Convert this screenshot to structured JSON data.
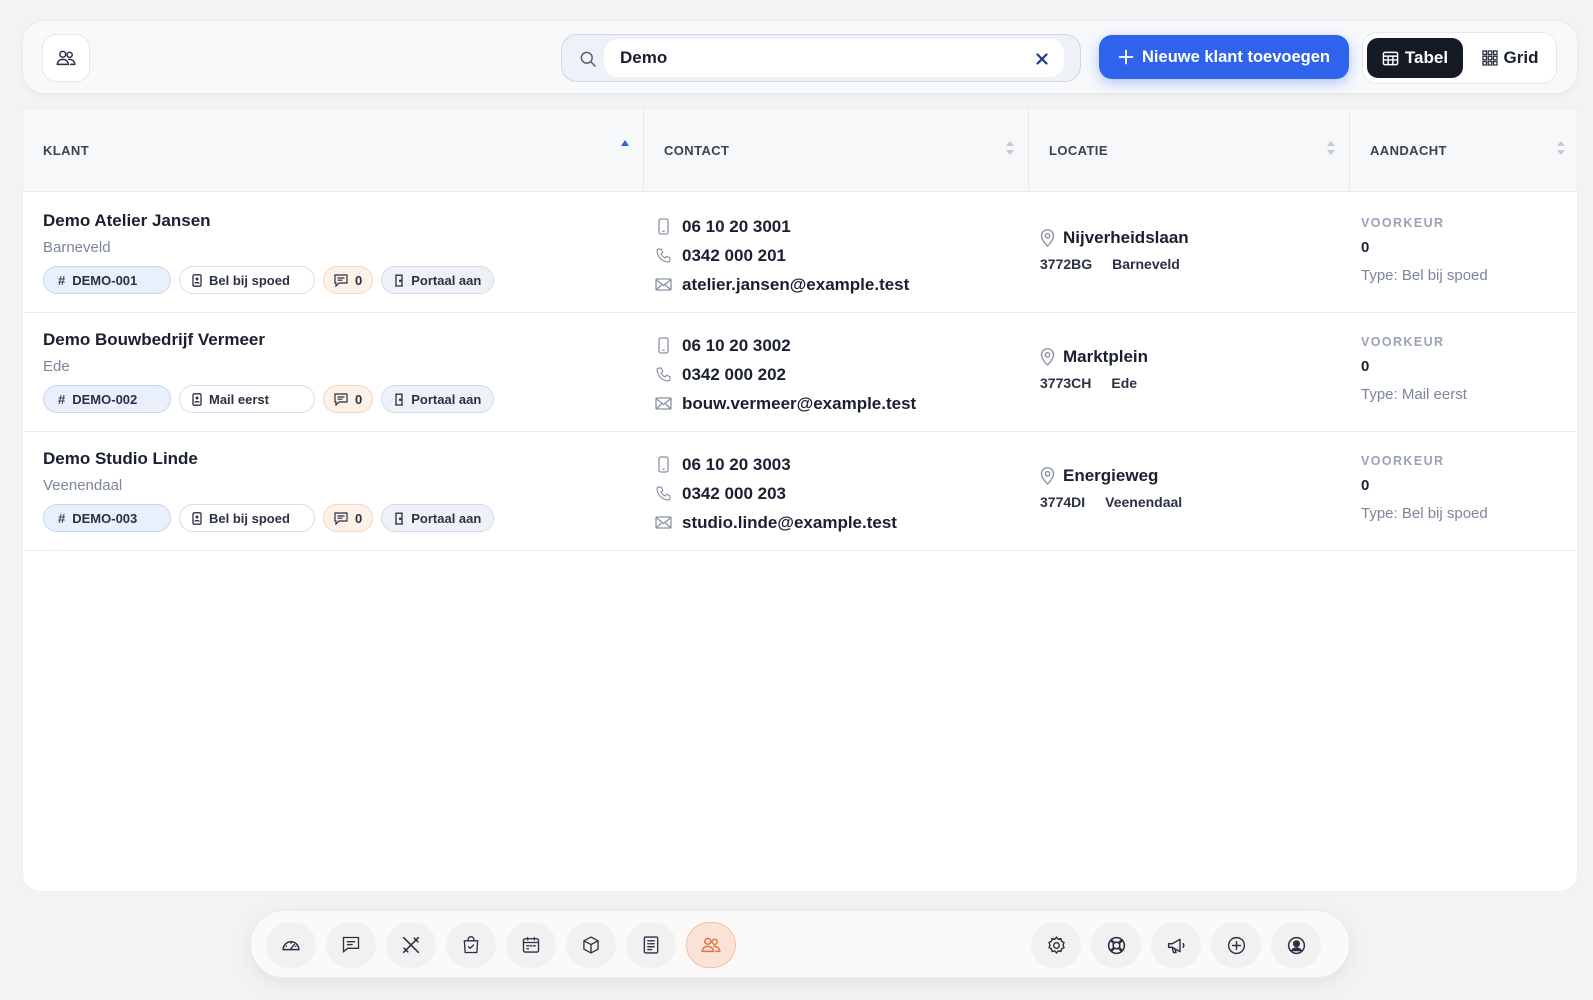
{
  "search": {
    "value": "Demo"
  },
  "actions": {
    "add_customer": "Nieuwe klant toevoegen"
  },
  "view_toggle": {
    "table": "Tabel",
    "grid": "Grid",
    "selected": "Tabel"
  },
  "table": {
    "columns": [
      {
        "label": "KLANT",
        "sort": "asc"
      },
      {
        "label": "CONTACT",
        "sort": "none"
      },
      {
        "label": "LOCATIE",
        "sort": "none"
      },
      {
        "label": "AANDACHT",
        "sort": "none"
      }
    ],
    "rows": [
      {
        "name": "Demo Atelier Jansen",
        "city": "Barneveld",
        "id": "DEMO-001",
        "preference": "Bel bij spoed",
        "notes": "0",
        "portal": "Portaal aan",
        "mobile": "06 10 20 3001",
        "phone": "0342 000 201",
        "email": "atelier.jansen@example.test",
        "street": "Nijverheidslaan",
        "postcode": "3772BG",
        "place": "Barneveld",
        "att_label": "VOORKEUR",
        "att_value": "0",
        "att_type": "Type: Bel bij spoed"
      },
      {
        "name": "Demo Bouwbedrijf Vermeer",
        "city": "Ede",
        "id": "DEMO-002",
        "preference": "Mail eerst",
        "notes": "0",
        "portal": "Portaal aan",
        "mobile": "06 10 20 3002",
        "phone": "0342 000 202",
        "email": "bouw.vermeer@example.test",
        "street": "Marktplein",
        "postcode": "3773CH",
        "place": "Ede",
        "att_label": "VOORKEUR",
        "att_value": "0",
        "att_type": "Type: Mail eerst"
      },
      {
        "name": "Demo Studio Linde",
        "city": "Veenendaal",
        "id": "DEMO-003",
        "preference": "Bel bij spoed",
        "notes": "0",
        "portal": "Portaal aan",
        "mobile": "06 10 20 3003",
        "phone": "0342 000 203",
        "email": "studio.linde@example.test",
        "street": "Energieweg",
        "postcode": "3774DI",
        "place": "Veenendaal",
        "att_label": "VOORKEUR",
        "att_value": "0",
        "att_type": "Type: Bel bij spoed"
      }
    ]
  },
  "dock": {
    "left_icons": [
      "dashboard-icon",
      "messages-icon",
      "tools-icon",
      "orders-icon",
      "calendar-icon",
      "box-icon",
      "invoice-icon",
      "customers-icon"
    ],
    "active": "customers-icon",
    "right_icons": [
      "settings-icon",
      "support-icon",
      "announcement-icon",
      "add-icon",
      "profile-icon"
    ]
  },
  "colors": {
    "accent": "#2f63ec",
    "dark": "#141a26",
    "active_dock": "#fbe2d6"
  }
}
